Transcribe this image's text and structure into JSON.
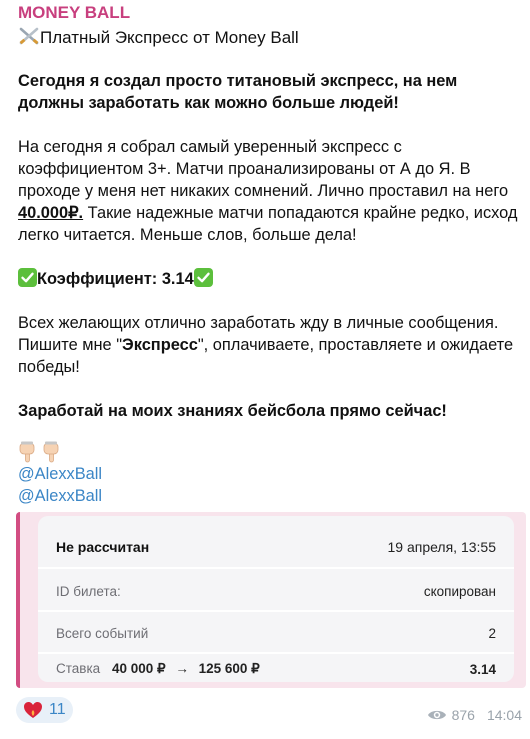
{
  "sender": "MONEY BALL",
  "title": "Платный Экспресс от Money Ball",
  "lead": "Сегодня я создал просто титановый экспресс, на нем должны заработать как можно больше людей!",
  "body": {
    "before": "На сегодня я собрал самый уверенный экспресс с коэффициентом 3+. Матчи проанализированы от А до Я. В проходе у меня нет никаких сомнений. Лично проставил на него ",
    "amount": "40.000₽.",
    "after": " Такие надежные матчи попадаются крайне редко, исход легко читается. Меньше слов, больше дела!"
  },
  "coef_line": "Коэффициент: 3.14",
  "invite": {
    "before": "Всех желающих отлично заработать жду в личные сообщения. Пишите мне \"",
    "keyword": "Экспресс",
    "after": "\", оплачиваете, проставляете и ожидаете победы!"
  },
  "cta": "Заработай на моих знаниях бейсбола прямо сейчас!",
  "links": [
    "@AlexxBall",
    "@AlexxBall"
  ],
  "ticket": {
    "status": "Не рассчитан",
    "date": "19 апреля, 13:55",
    "id_label": "ID билета:",
    "id_value": "скопирован",
    "events_label": "Всего событий",
    "events_value": "2",
    "stake_label": "Ставка",
    "stake_amount": "40 000 ₽",
    "arrow": "→",
    "payout": "125 600 ₽",
    "coef": "3.14"
  },
  "reaction_count": "11",
  "views": "876",
  "time": "14:04",
  "colors": {
    "sender": "#c83f7e",
    "link": "#3b86c6",
    "accent_bar": "#d24d82",
    "check": "#5cbf3c"
  }
}
